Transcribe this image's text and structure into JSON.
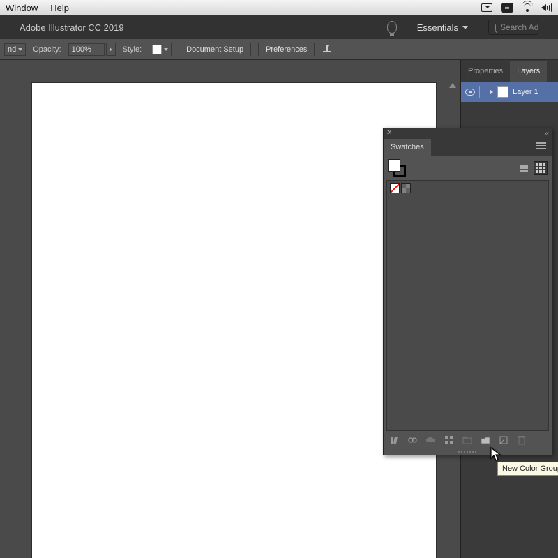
{
  "menubar": {
    "items": [
      "Window",
      "Help"
    ]
  },
  "titlebar": {
    "app": "Adobe Illustrator CC 2019",
    "workspace": "Essentials",
    "search_placeholder": "Search Adobe Stock"
  },
  "ctrlbar": {
    "blend_trunc": "nd",
    "opacity_label": "Opacity:",
    "opacity_value": "100%",
    "style_label": "Style:",
    "doc_setup": "Document Setup",
    "preferences": "Preferences"
  },
  "right_panel": {
    "tabs": [
      "Properties",
      "Layers"
    ],
    "active_tab": 1,
    "layer_name": "Layer 1"
  },
  "swatches": {
    "title": "Swatches",
    "footer_icons": [
      "libraries",
      "show-kinds",
      "cloud",
      "swatch-options",
      "new-group",
      "new-color-group",
      "new-swatch",
      "delete"
    ]
  },
  "tooltip": "New Color Group"
}
